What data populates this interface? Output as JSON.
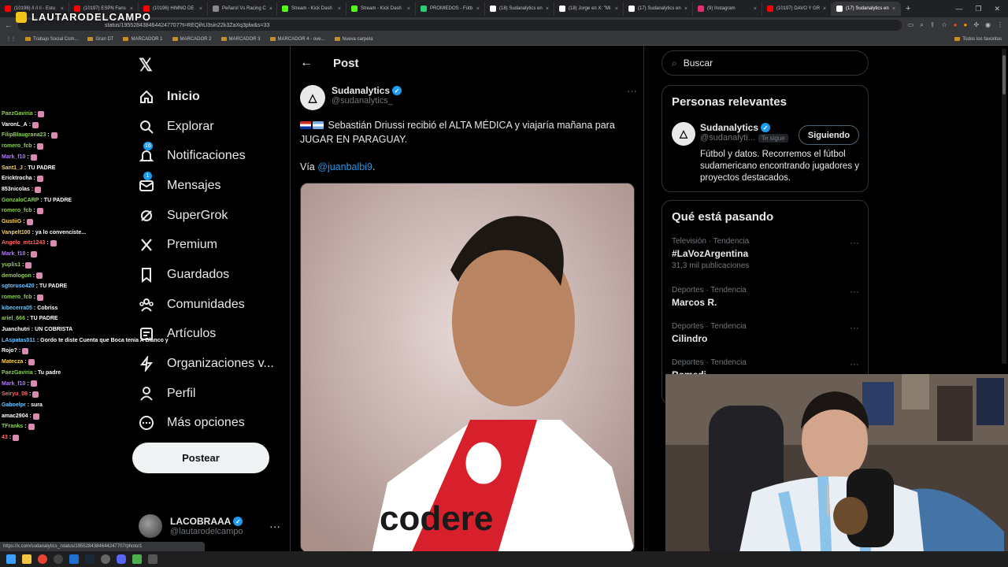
{
  "browser": {
    "tabs": [
      {
        "label": "(10196) /i /i /i - Estu",
        "color": "#ff0000"
      },
      {
        "label": "(10197) ESPN Fans",
        "color": "#ff0000"
      },
      {
        "label": "(10196) HIMNO DE",
        "color": "#ff0000"
      },
      {
        "label": "Peñarol Vs Racing C",
        "color": "#888888"
      },
      {
        "label": "Stream - Kick Dash",
        "color": "#53fc18"
      },
      {
        "label": "Stream - Kick Dash",
        "color": "#53fc18"
      },
      {
        "label": "PROMIEDOS - Fútb",
        "color": "#2ecc71"
      },
      {
        "label": "(18) Sudanalytics en",
        "color": "#ffffff"
      },
      {
        "label": "(18) Jorge en X: \"Mi",
        "color": "#ffffff"
      },
      {
        "label": "(17) Sudanalytics en",
        "color": "#ffffff"
      },
      {
        "label": "(9) Instagram",
        "color": "#e1306c"
      },
      {
        "label": "(10197) DAVO Y GR",
        "color": "#ff0000"
      },
      {
        "label": "(17) Sudanalytics en",
        "color": "#ffffff",
        "active": true
      }
    ],
    "url": "status/1955284384644247707?t=REQihU3sin22k3ZaXq3plw&s=33",
    "bookmarks": [
      "Trabajo Social Com...",
      "Gran DT",
      "MARCADOR 1",
      "MARCADOR 2",
      "MARCADOR 3",
      "MARCADOR 4 - ove...",
      "Nueva carpeta"
    ],
    "bookmarks_right": "Todos los favoritos",
    "status_url": "https://x.com/sudanalytics_/status/1955284384644247707/photo/1"
  },
  "overlay": {
    "logo_text": "LAUTARODELCAMPO"
  },
  "chat": [
    {
      "user": "PaezGaviria",
      "msg": "",
      "color": "#8fd14f"
    },
    {
      "user": "VaronL_A",
      "msg": "",
      "color": "#ffffff"
    },
    {
      "user": "FilipBlaugrana23",
      "msg": "",
      "color": "#8fd14f"
    },
    {
      "user": "romero_fcb",
      "msg": "",
      "color": "#8fd14f"
    },
    {
      "user": "Mark_f10",
      "msg": "",
      "color": "#b37cff"
    },
    {
      "user": "Sant1_J",
      "msg": "TU PADRE",
      "color": "#ffd34d"
    },
    {
      "user": "Ericktrocha",
      "msg": "",
      "color": "#ffffff"
    },
    {
      "user": "853nicolas",
      "msg": "",
      "color": "#ffffff"
    },
    {
      "user": "GonzaloCARP",
      "msg": "TU PADRE",
      "color": "#8fd14f"
    },
    {
      "user": "romero_fcb",
      "msg": "",
      "color": "#8fd14f"
    },
    {
      "user": "GustiiG",
      "msg": "",
      "color": "#ffd34d"
    },
    {
      "user": "Vanpelt100",
      "msg": "ya lo convenciste...",
      "color": "#ffd34d"
    },
    {
      "user": "Angelo_mtz1243",
      "msg": "",
      "color": "#ff6b6b"
    },
    {
      "user": "Mark_f10",
      "msg": "",
      "color": "#b37cff"
    },
    {
      "user": "yuplis1",
      "msg": "",
      "color": "#8fd14f"
    },
    {
      "user": "demologon",
      "msg": "",
      "color": "#8fd14f"
    },
    {
      "user": "sgtoruso420",
      "msg": "TU PADRE",
      "color": "#6ec6ff"
    },
    {
      "user": "romero_fcb",
      "msg": "",
      "color": "#8fd14f"
    },
    {
      "user": "kibecerra05",
      "msg": "Cobriss",
      "color": "#6ec6ff"
    },
    {
      "user": "ariel_666",
      "msg": "TU PADRE",
      "color": "#8fd14f"
    },
    {
      "user": "Juanchutri",
      "msg": "UN COBRISTA",
      "color": "#ffffff"
    },
    {
      "user": "LAspatas011",
      "msg": "Gordo te diste Cuenta que Boca tenia A Blanco y",
      "color": "#6ec6ff"
    },
    {
      "user": "Rojo?",
      "msg": "",
      "color": "#ffffff"
    },
    {
      "user": "Matecza",
      "msg": "",
      "color": "#ffd34d"
    },
    {
      "user": "PaezGaviria",
      "msg": "Tu padre",
      "color": "#8fd14f"
    },
    {
      "user": "Mark_f10",
      "msg": "",
      "color": "#b37cff"
    },
    {
      "user": "Seiryu_08",
      "msg": "",
      "color": "#ff6b6b"
    },
    {
      "user": "Gaboelpr",
      "msg": "sura",
      "color": "#6ec6ff"
    },
    {
      "user": "amac2904",
      "msg": "",
      "color": "#ffffff"
    },
    {
      "user": "TFranks",
      "msg": "",
      "color": "#8fd14f"
    },
    {
      "user": "43",
      "msg": "",
      "color": "#ff6b6b"
    }
  ],
  "nav": {
    "items": [
      {
        "label": "Inicio",
        "icon": "home-icon",
        "active": true
      },
      {
        "label": "Explorar",
        "icon": "search-icon"
      },
      {
        "label": "Notificaciones",
        "icon": "bell-icon",
        "badge": "16"
      },
      {
        "label": "Mensajes",
        "icon": "mail-icon",
        "badge": "1"
      },
      {
        "label": "SuperGrok",
        "icon": "grok-icon"
      },
      {
        "label": "Premium",
        "icon": "x-premium-icon"
      },
      {
        "label": "Guardados",
        "icon": "bookmark-icon"
      },
      {
        "label": "Comunidades",
        "icon": "communities-icon"
      },
      {
        "label": "Artículos",
        "icon": "articles-icon"
      },
      {
        "label": "Organizaciones v...",
        "icon": "lightning-icon"
      },
      {
        "label": "Perfil",
        "icon": "person-icon"
      },
      {
        "label": "Más opciones",
        "icon": "more-circle-icon"
      }
    ],
    "post_button": "Postear",
    "profile": {
      "name": "LACOBRAAA",
      "handle": "@lautarodelcampo"
    }
  },
  "main": {
    "title": "Post",
    "tweet": {
      "name": "Sudanalytics",
      "handle": "@sudanalytics_",
      "text": "Sebastián Driussi recibió el ALTA MÉDICA y viajaría mañana para JUGAR EN PARAGUAY.",
      "via_prefix": "Vía ",
      "via_link": "@juanbalbi9",
      "via_suffix": "."
    }
  },
  "right": {
    "search_placeholder": "Buscar",
    "relevant": {
      "title": "Personas relevantes",
      "name": "Sudanalytics",
      "handle": "@sudanalyti...",
      "follows_you": "Te sigue",
      "follow_button": "Siguiendo",
      "bio": "Fútbol y datos. Recorremos el fútbol sudamericano encontrando jugadores y proyectos destacados."
    },
    "trends_title": "Qué está pasando",
    "trends": [
      {
        "meta": "Televisión · Tendencia",
        "name": "#LaVozArgentina",
        "count": "31,3 mil publicaciones"
      },
      {
        "meta": "Deportes · Tendencia",
        "name": "Marcos R.",
        "count": ""
      },
      {
        "meta": "Deportes · Tendencia",
        "name": "Cilindro",
        "count": ""
      },
      {
        "meta": "Deportes · Tendencia",
        "name": "Romedi",
        "count": ""
      }
    ]
  },
  "colors": {
    "accent": "#1d9bf0",
    "background": "#000000",
    "border": "#2f3336"
  }
}
